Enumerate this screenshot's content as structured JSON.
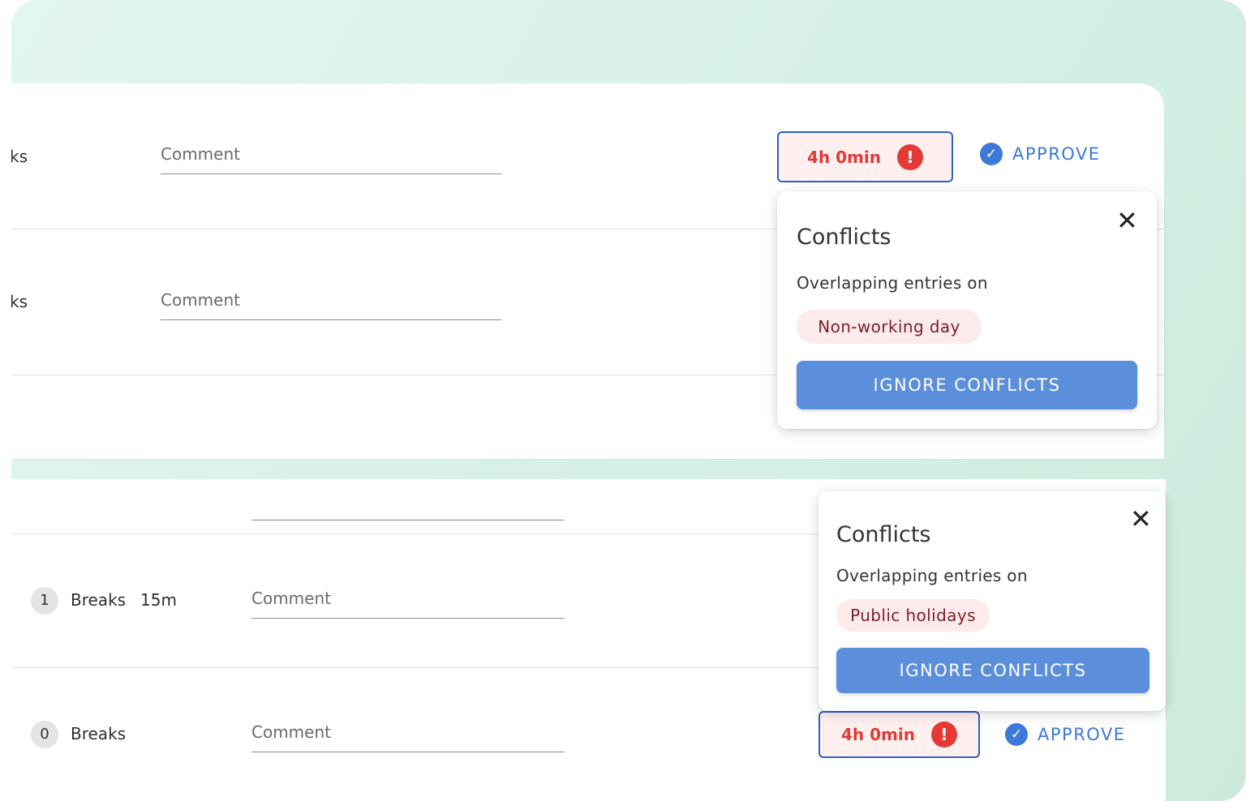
{
  "rows_top": [
    {
      "partial_label": "ks",
      "comment_placeholder": "Comment"
    },
    {
      "partial_label": "ks",
      "comment_placeholder": "Comment"
    }
  ],
  "rows_bottom": [
    {
      "count": "1",
      "breaks_label": "Breaks",
      "breaks_duration": "15m",
      "comment_placeholder": "Comment"
    },
    {
      "count": "0",
      "breaks_label": "Breaks",
      "comment_placeholder": "Comment"
    }
  ],
  "entry_top": {
    "duration": "4h 0min",
    "alert_glyph": "!",
    "approve_label": "APPROVE"
  },
  "entry_bottom": {
    "duration": "4h 0min",
    "alert_glyph": "!",
    "approve_label": "APPROVE"
  },
  "popover_top": {
    "title": "Conflicts",
    "subtitle": "Overlapping entries on",
    "chip": "Non-working day",
    "button": "IGNORE CONFLICTS",
    "close_glyph": "✕"
  },
  "popover_bottom": {
    "title": "Conflicts",
    "subtitle": "Overlapping entries on",
    "chip": "Public holidays",
    "button": "IGNORE CONFLICTS",
    "close_glyph": "✕"
  },
  "icons": {
    "check": "check-circle-icon",
    "alert": "alert-circle-icon",
    "close": "close-icon"
  },
  "colors": {
    "accent": "#3d79d8",
    "danger": "#e53935",
    "button": "#5b8edb",
    "chip_bg": "#fdeaea",
    "background": "#d7f0e6"
  }
}
